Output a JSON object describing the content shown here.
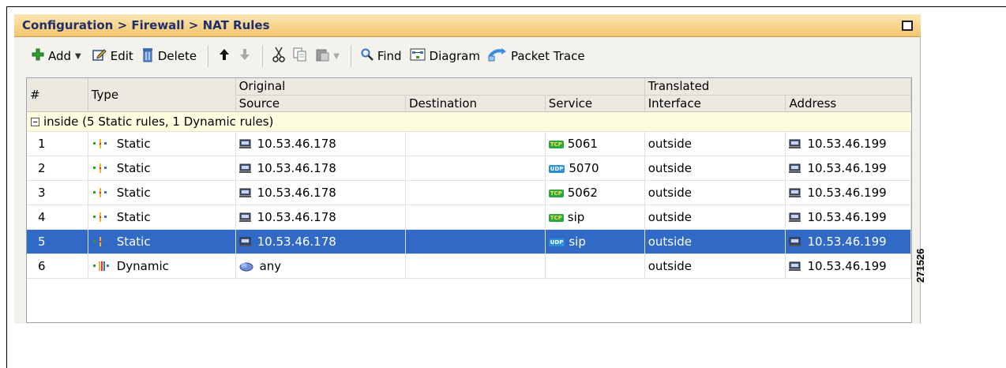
{
  "window": {
    "title": "Configuration > Firewall > NAT Rules"
  },
  "toolbar": {
    "add_label": "Add",
    "edit_label": "Edit",
    "delete_label": "Delete",
    "find_label": "Find",
    "diagram_label": "Diagram",
    "packet_trace_label": "Packet Trace"
  },
  "table": {
    "group_headers": {
      "original": "Original",
      "translated": "Translated"
    },
    "columns": {
      "num": "#",
      "type": "Type",
      "source": "Source",
      "destination": "Destination",
      "service": "Service",
      "interface": "Interface",
      "address": "Address"
    },
    "section_label": "inside (5 Static rules, 1 Dynamic rules)",
    "rows": [
      {
        "num": "1",
        "type": "Static",
        "source": "10.53.46.178",
        "destination": "",
        "service_proto": "TCP",
        "service": "5061",
        "interface": "outside",
        "address": "10.53.46.199"
      },
      {
        "num": "2",
        "type": "Static",
        "source": "10.53.46.178",
        "destination": "",
        "service_proto": "UDP",
        "service": "5070",
        "interface": "outside",
        "address": "10.53.46.199"
      },
      {
        "num": "3",
        "type": "Static",
        "source": "10.53.46.178",
        "destination": "",
        "service_proto": "TCP",
        "service": "5062",
        "interface": "outside",
        "address": "10.53.46.199"
      },
      {
        "num": "4",
        "type": "Static",
        "source": "10.53.46.178",
        "destination": "",
        "service_proto": "TCP",
        "service": "sip",
        "interface": "outside",
        "address": "10.53.46.199"
      },
      {
        "num": "5",
        "type": "Static",
        "source": "10.53.46.178",
        "destination": "",
        "service_proto": "UDP",
        "service": "sip",
        "interface": "outside",
        "address": "10.53.46.199"
      },
      {
        "num": "6",
        "type": "Dynamic",
        "source": "any",
        "destination": "",
        "service_proto": "",
        "service": "",
        "interface": "outside",
        "address": "10.53.46.199"
      }
    ],
    "selected_row": "5"
  },
  "figure_id": "271526",
  "colors": {
    "title_text": "#1f2f6b",
    "title_bg": "#f3c56e",
    "selection": "#3169c6",
    "section_bg": "#fffde0",
    "tcp_badge": "#28a745",
    "udp_badge": "#2b8fd8"
  },
  "icons": {
    "add": "plus-icon",
    "edit": "pencil-icon",
    "delete": "trash-icon",
    "move_up": "arrow-up-icon",
    "move_down": "arrow-down-icon",
    "cut": "scissors-icon",
    "copy": "copy-icon",
    "paste": "paste-icon",
    "find": "magnifier-icon",
    "diagram": "diagram-icon",
    "packet_trace": "packet-trace-icon",
    "host": "computer-icon",
    "any": "network-cloud-icon"
  }
}
